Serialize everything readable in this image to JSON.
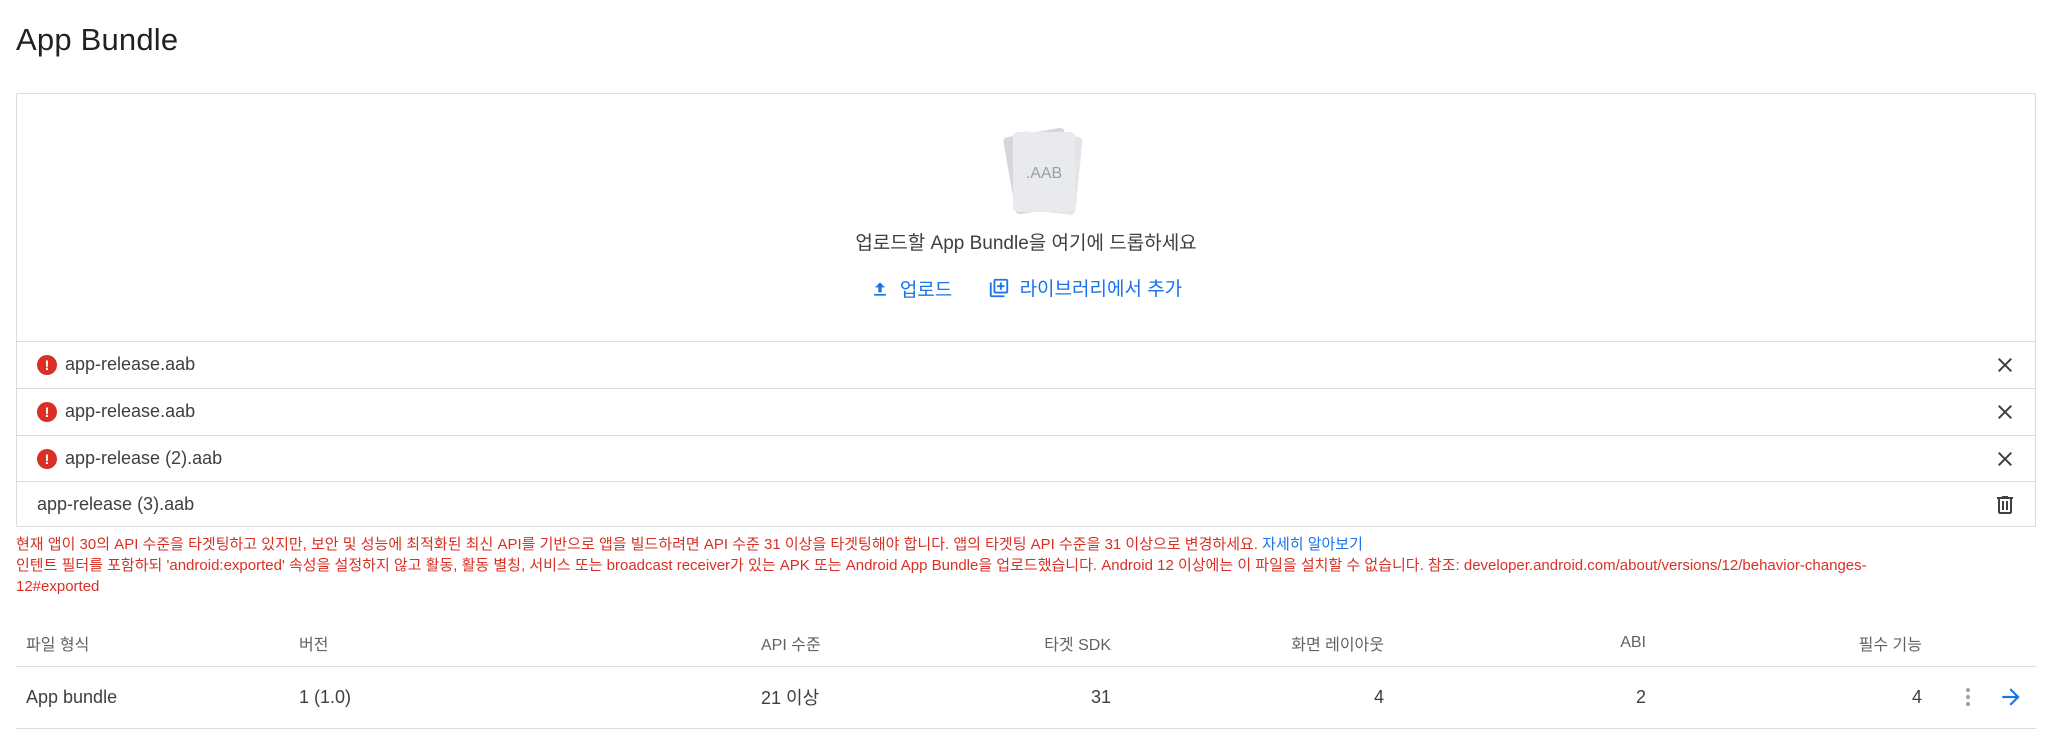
{
  "page": {
    "title": "App Bundle"
  },
  "dropzone": {
    "file_icon_text": ".AAB",
    "drop_text": "업로드할 App Bundle을 여기에 드롭하세요",
    "upload_label": "업로드",
    "library_label": "라이브러리에서 추가"
  },
  "files": [
    {
      "name": "app-release.aab",
      "status": "error",
      "action_icon": "close-icon"
    },
    {
      "name": "app-release.aab",
      "status": "error",
      "action_icon": "close-icon"
    },
    {
      "name": "app-release (2).aab",
      "status": "error",
      "action_icon": "close-icon"
    },
    {
      "name": "app-release (3).aab",
      "status": "ok",
      "action_icon": "trash-icon"
    }
  ],
  "warnings": {
    "line1": "현재 앱이 30의 API 수준을 타겟팅하고 있지만, 보안 및 성능에 최적화된 최신 API를 기반으로 앱을 빌드하려면 API 수준 31 이상을 타겟팅해야 합니다. 앱의 타겟팅 API 수준을 31 이상으로 변경하세요.",
    "line1_link": "자세히 알아보기",
    "line2": "인텐트 필터를 포함하되 'android:exported' 속성을 설정하지 않고 활동, 활동 별칭, 서비스 또는 broadcast receiver가 있는 APK 또는 Android App Bundle을 업로드했습니다. Android 12 이상에는 이 파일을 설치할 수 없습니다. 참조: developer.android.com/about/versions/12/behavior-changes-",
    "line3": "12#exported"
  },
  "table": {
    "headers": [
      "파일 형식",
      "버전",
      "API 수준",
      "타겟 SDK",
      "화면 레이아웃",
      "ABI",
      "필수 기능"
    ],
    "row": [
      "App bundle",
      "1 (1.0)",
      "21 이상",
      "31",
      "4",
      "2",
      "4"
    ]
  },
  "colors": {
    "error": "#d93025",
    "link": "#1a73e8",
    "divider": "#dadce0"
  }
}
